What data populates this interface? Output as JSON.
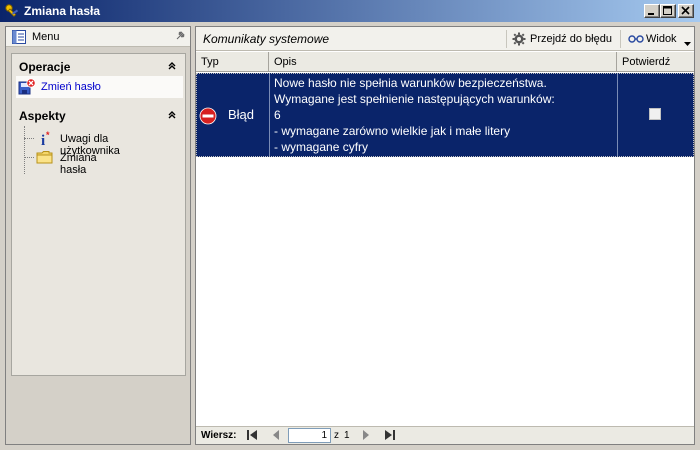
{
  "window": {
    "title": "Zmiana hasła"
  },
  "left_panel": {
    "header_label": "Menu",
    "sections": {
      "operacje": {
        "label": "Operacje",
        "items": [
          {
            "label": "Zmień hasło",
            "icon": "change-password-icon"
          }
        ]
      },
      "aspekty": {
        "label": "Aspekty",
        "items": [
          {
            "label": "Uwagi dla użytkownika",
            "icon": "info-icon"
          },
          {
            "label": "Zmiana hasła",
            "icon": "folder-icon"
          }
        ]
      }
    }
  },
  "main": {
    "title": "Komunikaty systemowe",
    "toolbar": {
      "goto_label": "Przejdź do błędu",
      "view_label": "Widok"
    },
    "grid": {
      "columns": [
        "Typ",
        "Opis",
        "Potwierdź"
      ],
      "rows": [
        {
          "type": "Błąd",
          "description_lines": [
            "Nowe hasło nie spełnia warunków bezpieczeństwa.",
            "Wymagane jest spełnienie następujących warunków:",
            "6",
            "- wymagane zarówno wielkie jak i małe litery",
            "- wymagane cyfry"
          ],
          "confirmed": false
        }
      ]
    },
    "pager": {
      "label": "Wiersz:",
      "current": "1",
      "of_label": "z",
      "total": "1"
    }
  },
  "colors": {
    "selection": "#0a246a",
    "error": "#d62020",
    "link": "#0000cc"
  }
}
